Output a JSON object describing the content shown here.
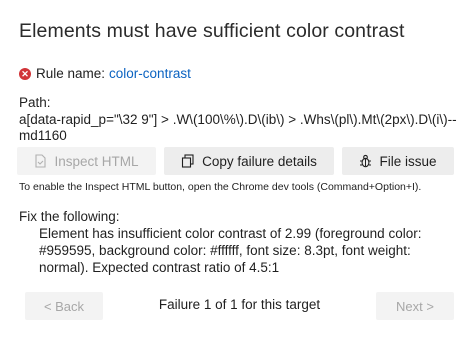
{
  "title": "Elements must have sufficient color contrast",
  "rule": {
    "label": "Rule name:",
    "name": "color-contrast"
  },
  "path": {
    "label": "Path:",
    "value": "a[data-rapid_p=\"\\32 9\"] > .W\\(100\\%\\).D\\(ib\\) > .Whs\\(pl\\).Mt\\(2px\\).D\\(i\\)--md1160"
  },
  "buttons": {
    "inspect_html": "Inspect HTML",
    "copy_failure": "Copy failure details",
    "file_issue": "File issue"
  },
  "hint": "To enable the Inspect HTML button, open the Chrome dev tools (Command+Option+I).",
  "fix": {
    "label": "Fix the following:",
    "text": "Element has insufficient color contrast of 2.99 (foreground color: #959595, background color: #ffffff, font size: 8.3pt, font weight: normal). Expected contrast ratio of 4.5:1"
  },
  "navigation": {
    "back": "< Back",
    "status": "Failure 1 of 1 for this target",
    "next": "Next >"
  },
  "colors": {
    "link": "#0b63c1",
    "error": "#d13438"
  },
  "icons": [
    "error-icon",
    "inspect-icon",
    "copy-icon",
    "bug-icon"
  ]
}
